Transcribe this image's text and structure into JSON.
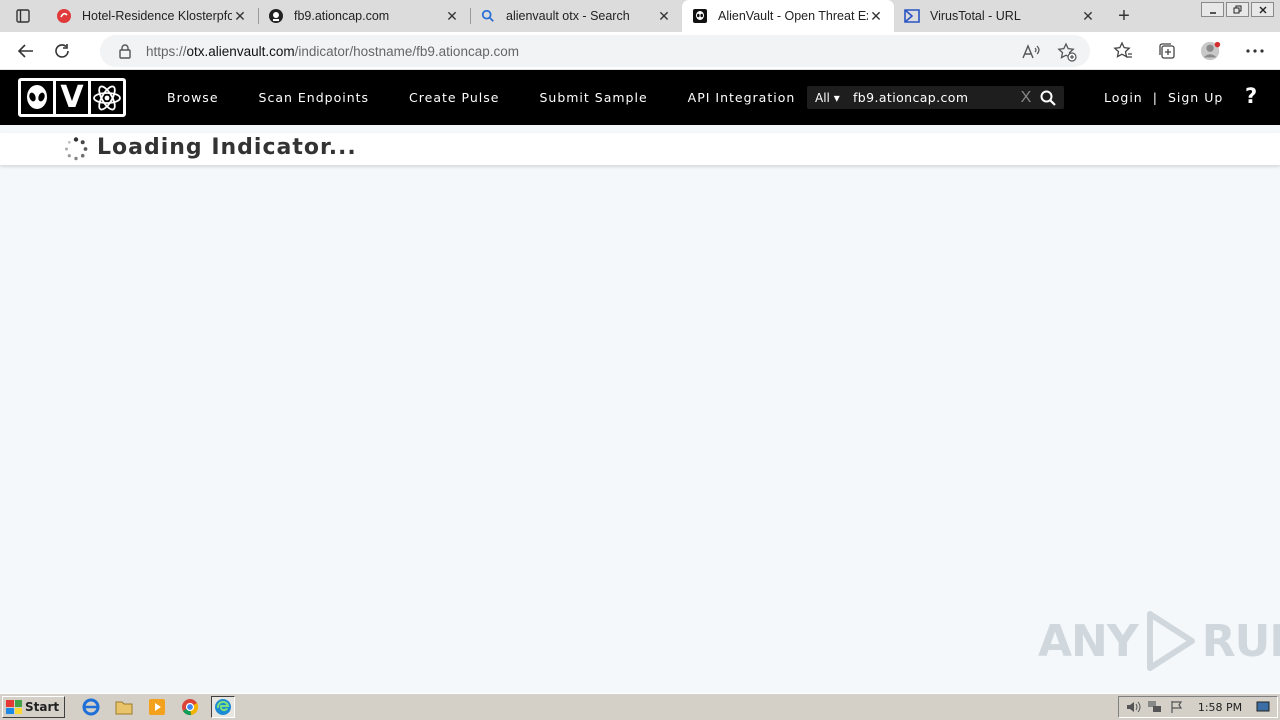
{
  "browser": {
    "tabs": [
      {
        "title": "Hotel-Residence Klosterpfor",
        "icon": "hotel-favicon",
        "active": false
      },
      {
        "title": "fb9.ationcap.com",
        "icon": "hacker-favicon",
        "active": false
      },
      {
        "title": "alienvault otx - Search",
        "icon": "search-favicon",
        "active": false
      },
      {
        "title": "AlienVault - Open Threat Ex",
        "icon": "alienvault-favicon",
        "active": true
      },
      {
        "title": "VirusTotal - URL",
        "icon": "virustotal-favicon",
        "active": false
      }
    ],
    "close_glyph": "✕",
    "new_tab_glyph": "+",
    "url_prefix": "https://",
    "url_host": "otx.alienvault.com",
    "url_path": "/indicator/hostname/fb9.ationcap.com"
  },
  "otx": {
    "logo_letter": "V",
    "nav": {
      "browse": "Browse",
      "scan": "Scan Endpoints",
      "pulse": "Create Pulse",
      "submit": "Submit Sample",
      "api": "API Integration"
    },
    "search": {
      "scope": "All ▾",
      "value": "fb9.ationcap.com",
      "clear": "X"
    },
    "auth": {
      "login": "Login",
      "separator": "|",
      "signup": "Sign Up"
    },
    "help": "?",
    "loading_text": "Loading Indicator..."
  },
  "watermark": {
    "left": "ANY",
    "right": "RUN"
  },
  "taskbar": {
    "start": "Start",
    "clock": "1:58 PM"
  },
  "colors": {
    "header_bg": "#000000",
    "page_bg": "#f4f8fb",
    "tabstrip_bg": "#dcdcdc",
    "taskbar_bg": "#d4d0c8"
  }
}
